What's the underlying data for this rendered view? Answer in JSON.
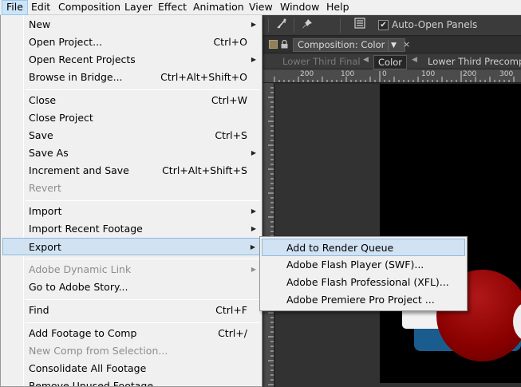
{
  "menubar": {
    "items": [
      {
        "label": "File"
      },
      {
        "label": "Edit"
      },
      {
        "label": "Composition"
      },
      {
        "label": "Layer"
      },
      {
        "label": "Effect"
      },
      {
        "label": "Animation"
      },
      {
        "label": "View"
      },
      {
        "label": "Window"
      },
      {
        "label": "Help"
      }
    ]
  },
  "toolbar": {
    "auto_open_label": "Auto-Open Panels",
    "auto_open_checked": true,
    "check_glyph": "✔",
    "icons": [
      "puppet-tool-icon",
      "pin-tool-icon",
      "panel-menu-icon"
    ]
  },
  "composition": {
    "tab_label": "Composition: Color",
    "close_glyph": "×",
    "dropdown_glyph": "▼",
    "breadcrumbs": [
      {
        "label": "Lower Third Final",
        "state": "dimmed"
      },
      {
        "label": "Color",
        "state": "active"
      },
      {
        "label": "Lower Third Precomp",
        "state": "normal"
      }
    ],
    "ruler_labels": [
      "200",
      "100",
      "0",
      "100",
      "200",
      "300"
    ]
  },
  "file_menu": {
    "items": [
      {
        "label": "New",
        "shortcut": "",
        "submenu": true,
        "disabled": false
      },
      {
        "label": "Open Project...",
        "shortcut": "Ctrl+O",
        "submenu": false,
        "disabled": false
      },
      {
        "label": "Open Recent Projects",
        "shortcut": "",
        "submenu": true,
        "disabled": false
      },
      {
        "label": "Browse in Bridge...",
        "shortcut": "Ctrl+Alt+Shift+O",
        "submenu": false,
        "disabled": false
      },
      {
        "label": "Close",
        "shortcut": "Ctrl+W",
        "submenu": false,
        "disabled": false
      },
      {
        "label": "Close Project",
        "shortcut": "",
        "submenu": false,
        "disabled": false
      },
      {
        "label": "Save",
        "shortcut": "Ctrl+S",
        "submenu": false,
        "disabled": false
      },
      {
        "label": "Save As",
        "shortcut": "",
        "submenu": true,
        "disabled": false
      },
      {
        "label": "Increment and Save",
        "shortcut": "Ctrl+Alt+Shift+S",
        "submenu": false,
        "disabled": false
      },
      {
        "label": "Revert",
        "shortcut": "",
        "submenu": false,
        "disabled": true
      },
      {
        "label": "Import",
        "shortcut": "",
        "submenu": true,
        "disabled": false
      },
      {
        "label": "Import Recent Footage",
        "shortcut": "",
        "submenu": true,
        "disabled": false
      },
      {
        "label": "Export",
        "shortcut": "",
        "submenu": true,
        "disabled": false,
        "highlighted": true
      },
      {
        "label": "Adobe Dynamic Link",
        "shortcut": "",
        "submenu": true,
        "disabled": true
      },
      {
        "label": "Go to Adobe Story...",
        "shortcut": "",
        "submenu": false,
        "disabled": false
      },
      {
        "label": "Find",
        "shortcut": "Ctrl+F",
        "submenu": false,
        "disabled": false
      },
      {
        "label": "Add Footage to Comp",
        "shortcut": "Ctrl+/",
        "submenu": false,
        "disabled": false
      },
      {
        "label": "New Comp from Selection...",
        "shortcut": "",
        "submenu": false,
        "disabled": true
      },
      {
        "label": "Consolidate All Footage",
        "shortcut": "",
        "submenu": false,
        "disabled": false
      },
      {
        "label": "Remove Unused Footage",
        "shortcut": "",
        "submenu": false,
        "disabled": false
      }
    ],
    "submenu_arrow": "▶"
  },
  "export_submenu": {
    "items": [
      {
        "label": "Add to Render Queue",
        "highlighted": true
      },
      {
        "label": "Adobe Flash Player (SWF)..."
      },
      {
        "label": "Adobe Flash Professional (XFL)..."
      },
      {
        "label": "Adobe Premiere Pro Project ..."
      }
    ]
  },
  "colors": {
    "menu_bg": "#f0f0f0",
    "highlight": "#d1e2f2",
    "app_bg": "#323232",
    "accent_red": "#8a0000",
    "accent_blue": "#1b5c8f"
  }
}
